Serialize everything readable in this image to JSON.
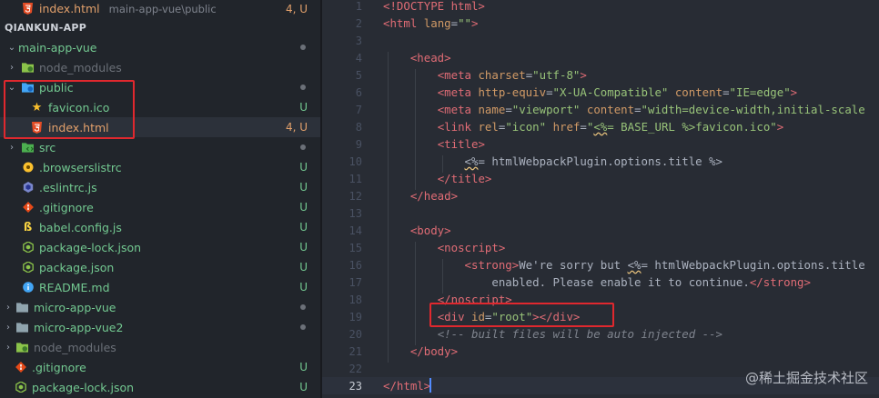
{
  "sidebar": {
    "open_editor": {
      "name": "index.html",
      "path": "main-app-vue\\public",
      "badge": "4, U"
    },
    "section_title": "QIANKUN-APP",
    "tree": [
      {
        "label": "main-app-vue",
        "badge": "",
        "chevron": "⌄"
      },
      {
        "label": "node_modules",
        "badge": "",
        "chevron": "›"
      },
      {
        "label": "public",
        "badge": "",
        "chevron": "⌄"
      },
      {
        "label": "favicon.ico",
        "badge": "U",
        "chevron": ""
      },
      {
        "label": "index.html",
        "badge": "4, U",
        "chevron": ""
      },
      {
        "label": "src",
        "badge": "",
        "chevron": "›"
      },
      {
        "label": ".browserslistrc",
        "badge": "U",
        "chevron": ""
      },
      {
        "label": ".eslintrc.js",
        "badge": "U",
        "chevron": ""
      },
      {
        "label": ".gitignore",
        "badge": "U",
        "chevron": ""
      },
      {
        "label": "babel.config.js",
        "badge": "U",
        "chevron": ""
      },
      {
        "label": "package-lock.json",
        "badge": "U",
        "chevron": ""
      },
      {
        "label": "package.json",
        "badge": "U",
        "chevron": ""
      },
      {
        "label": "README.md",
        "badge": "U",
        "chevron": ""
      },
      {
        "label": "micro-app-vue",
        "badge": "",
        "chevron": "›"
      },
      {
        "label": "micro-app-vue2",
        "badge": "",
        "chevron": "›"
      },
      {
        "label": "node_modules",
        "badge": "",
        "chevron": "›"
      },
      {
        "label": ".gitignore",
        "badge": "U",
        "chevron": ""
      },
      {
        "label": "package-lock.json",
        "badge": "U",
        "chevron": ""
      }
    ]
  },
  "editor": {
    "lines": [
      {
        "n": "1",
        "html": "<span class=\"tag\">&lt;!DOCTYPE html&gt;</span>"
      },
      {
        "n": "2",
        "html": "<span class=\"tag\">&lt;html</span> <span class=\"attr\">lang</span>=<span class=\"str\">\"\"</span><span class=\"tag\">&gt;</span>"
      },
      {
        "n": "3",
        "html": ""
      },
      {
        "n": "4",
        "html": "    <span class=\"tag\">&lt;head&gt;</span>"
      },
      {
        "n": "5",
        "html": "        <span class=\"tag\">&lt;meta</span> <span class=\"attr\">charset</span>=<span class=\"str\">\"utf-8\"</span><span class=\"tag\">&gt;</span>"
      },
      {
        "n": "6",
        "html": "        <span class=\"tag\">&lt;meta</span> <span class=\"attr\">http-equiv</span>=<span class=\"str\">\"X-UA-Compatible\"</span> <span class=\"attr\">content</span>=<span class=\"str\">\"IE=edge\"</span><span class=\"tag\">&gt;</span>"
      },
      {
        "n": "7",
        "html": "        <span class=\"tag\">&lt;meta</span> <span class=\"attr\">name</span>=<span class=\"str\">\"viewport\"</span> <span class=\"attr\">content</span>=<span class=\"str\">\"width=device-width,initial-scale</span>"
      },
      {
        "n": "8",
        "html": "        <span class=\"tag\">&lt;link</span> <span class=\"attr\">rel</span>=<span class=\"str\">\"icon\"</span> <span class=\"attr\">href</span>=<span class=\"str\">\"<span class=\"und\">&lt;%</span>= BASE_URL %&gt;favicon.ico\"</span><span class=\"tag\">&gt;</span>"
      },
      {
        "n": "9",
        "html": "        <span class=\"tag\">&lt;title&gt;</span>"
      },
      {
        "n": "10",
        "html": "            <span class=\"und\">&lt;%</span>= htmlWebpackPlugin.options.title %&gt;"
      },
      {
        "n": "11",
        "html": "        <span class=\"tag\">&lt;/title&gt;</span>"
      },
      {
        "n": "12",
        "html": "    <span class=\"tag\">&lt;/head&gt;</span>"
      },
      {
        "n": "13",
        "html": ""
      },
      {
        "n": "14",
        "html": "    <span class=\"tag\">&lt;body&gt;</span>"
      },
      {
        "n": "15",
        "html": "        <span class=\"tag\">&lt;noscript&gt;</span>"
      },
      {
        "n": "16",
        "html": "            <span class=\"tag\">&lt;strong&gt;</span>We're sorry but <span class=\"und\">&lt;%</span>= htmlWebpackPlugin.options.title"
      },
      {
        "n": "17",
        "html": "                enabled. Please enable it to continue.<span class=\"tag\">&lt;/strong&gt;</span>"
      },
      {
        "n": "18",
        "html": "        <span class=\"tag\">&lt;/noscript&gt;</span>"
      },
      {
        "n": "19",
        "html": "        <span class=\"tag\">&lt;div</span> <span class=\"attr\">id</span>=<span class=\"str\">\"root\"</span><span class=\"tag\">&gt;&lt;/div&gt;</span>"
      },
      {
        "n": "20",
        "html": "        <span class=\"com\">&lt;!-- built files will be auto injected --&gt;</span>"
      },
      {
        "n": "21",
        "html": "    <span class=\"tag\">&lt;/body&gt;</span>"
      },
      {
        "n": "22",
        "html": ""
      },
      {
        "n": "23",
        "html": "<span class=\"tag\">&lt;/html&gt;</span>"
      }
    ]
  },
  "watermark": "@稀土掘金技术社区",
  "colors": {
    "sidebar_bg": "#21252b",
    "editor_bg": "#282c34",
    "highlight_red": "#e0282e",
    "git_untracked": "#73c991",
    "git_modified": "#e2a06b"
  }
}
